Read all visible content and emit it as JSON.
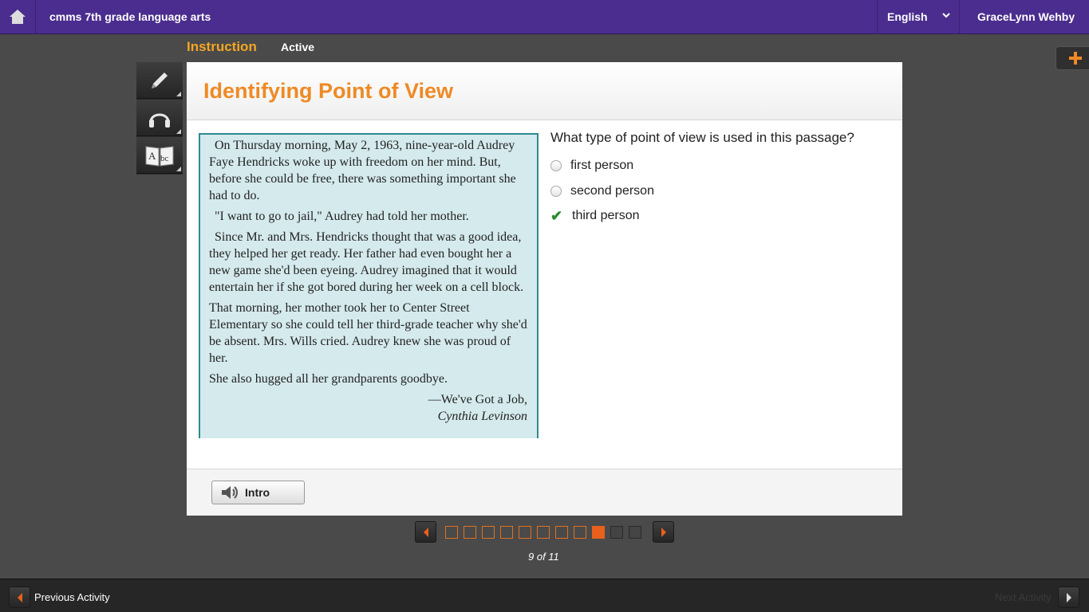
{
  "header": {
    "course_title": "cmms 7th grade language arts",
    "language": "English",
    "user": "GraceLynn Wehby"
  },
  "subheader": {
    "section": "Instruction",
    "status": "Active"
  },
  "tools": [
    {
      "icon": "pencil-icon"
    },
    {
      "icon": "headphones-icon"
    },
    {
      "icon": "dictionary-icon",
      "label": "Abc"
    }
  ],
  "activity": {
    "title": "Identifying Point of View",
    "passage": [
      "On Thursday morning, May 2, 1963, nine-year-old Audrey Faye Hendricks woke up with freedom on her mind. But, before she could be free, there was something important she had to do.",
      "\"I want to go to jail,\" Audrey had told her mother.",
      "Since Mr. and Mrs. Hendricks thought that was a good idea, they helped her get ready. Her father had even bought her a new game she'd been eyeing. Audrey imagined that it would entertain her if she got bored during her week on a cell block.",
      "That morning, her mother took her to Center Street Elementary so she could tell her third-grade teacher why she'd be absent. Mrs. Wills cried. Audrey knew she was proud of her.",
      "She also hugged all her grandparents goodbye."
    ],
    "source_line": "—We've Got a Job,",
    "source_author": "Cynthia Levinson",
    "question": "What type of point of view is used in this passage?",
    "options": [
      {
        "label": "first person",
        "state": "unselected"
      },
      {
        "label": "second person",
        "state": "unselected"
      },
      {
        "label": "third person",
        "state": "correct"
      }
    ],
    "intro_button": "Intro"
  },
  "pager": {
    "current": 9,
    "total": 11,
    "label": "9 of 11"
  },
  "footer": {
    "previous": "Previous Activity",
    "next": "Next Activity"
  },
  "colors": {
    "topbar": "#4a2d8e",
    "accent_orange": "#ee8a24",
    "passage_bg": "#d5eaed",
    "passage_border": "#2e8b8f",
    "check_green": "#2e8b2e"
  }
}
